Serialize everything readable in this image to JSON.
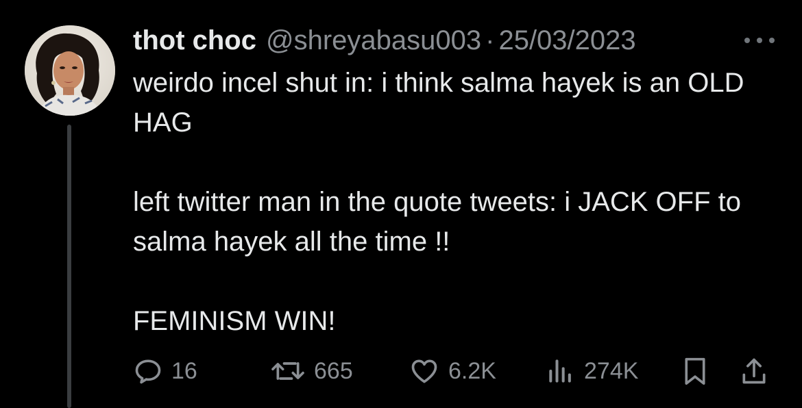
{
  "tweet": {
    "display_name": "thot choc",
    "handle": "@shreyabasu003",
    "separator": "·",
    "date": "25/03/2023",
    "paragraphs": [
      "weirdo incel shut in: i think salma hayek is an OLD HAG",
      "left twitter man in the quote tweets: i JACK OFF to salma hayek all the time !!",
      "FEMINISM WIN!"
    ]
  },
  "actions": {
    "replies": "16",
    "retweets": "665",
    "likes": "6.2K",
    "views": "274K"
  },
  "icons": {
    "reply": "reply-icon",
    "retweet": "retweet-icon",
    "like": "heart-icon",
    "views": "views-chart-icon",
    "bookmark": "bookmark-icon",
    "share": "share-icon",
    "more": "more-icon"
  },
  "colors": {
    "background": "#000000",
    "primary_text": "#e7e9ea",
    "secondary_text": "#8b8f94",
    "thread_line": "#3a3d40"
  }
}
